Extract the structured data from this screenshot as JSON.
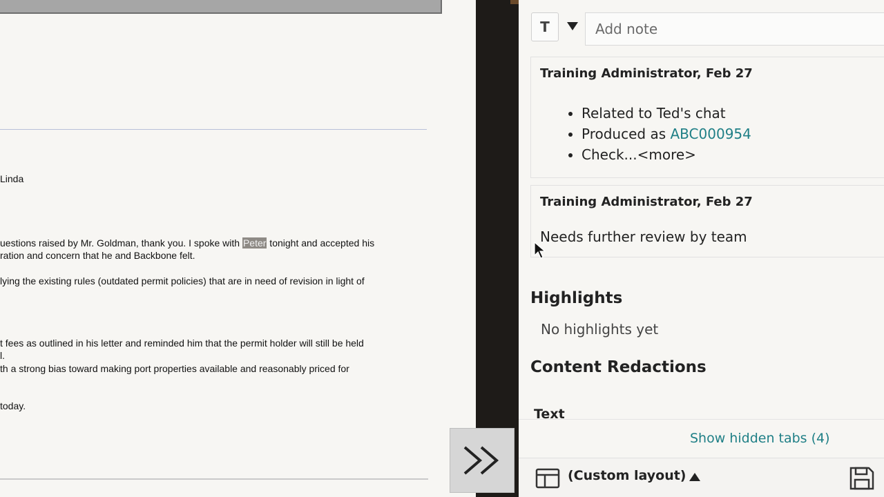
{
  "document": {
    "lines": [
      {
        "text": "Linda"
      },
      {
        "pre": "uestions raised by Mr. Goldman, thank you.  I spoke with ",
        "highlight": "Peter",
        "post": " tonight and accepted his"
      },
      {
        "text": "ration and concern that he and Backbone felt."
      },
      {
        "text": "lying the existing rules (outdated permit policies) that are in need of revision in light of"
      },
      {
        "text": "t fees as outlined in his letter and reminded him that the permit holder will still be held"
      },
      {
        "text": "l."
      },
      {
        "text": "th a strong bias toward making port properties available and reasonably priced for"
      },
      {
        "text": "today."
      }
    ]
  },
  "divider": {
    "expand_icon": "double-chevron-right-icon"
  },
  "notes_panel": {
    "type_button_label": "T",
    "note_placeholder": "Add note",
    "notes": [
      {
        "author": "Training Administrator, Feb 27",
        "items": [
          {
            "text": "Related to Ted's chat"
          },
          {
            "text": "Produced as ",
            "link": "ABC000954"
          },
          {
            "text": "Check...<more>"
          }
        ]
      },
      {
        "author": "Training Administrator, Feb 27",
        "text": "Needs further review by team"
      }
    ],
    "highlights_title": "Highlights",
    "no_highlights": "No highlights yet",
    "redactions_title": "Content Redactions",
    "redactions_sub": "Text",
    "show_hidden_tabs": "Show hidden tabs (4)",
    "layout_label": "(Custom layout)",
    "colors": {
      "link": "#1f7f86",
      "divider": "#1e1b18"
    }
  }
}
